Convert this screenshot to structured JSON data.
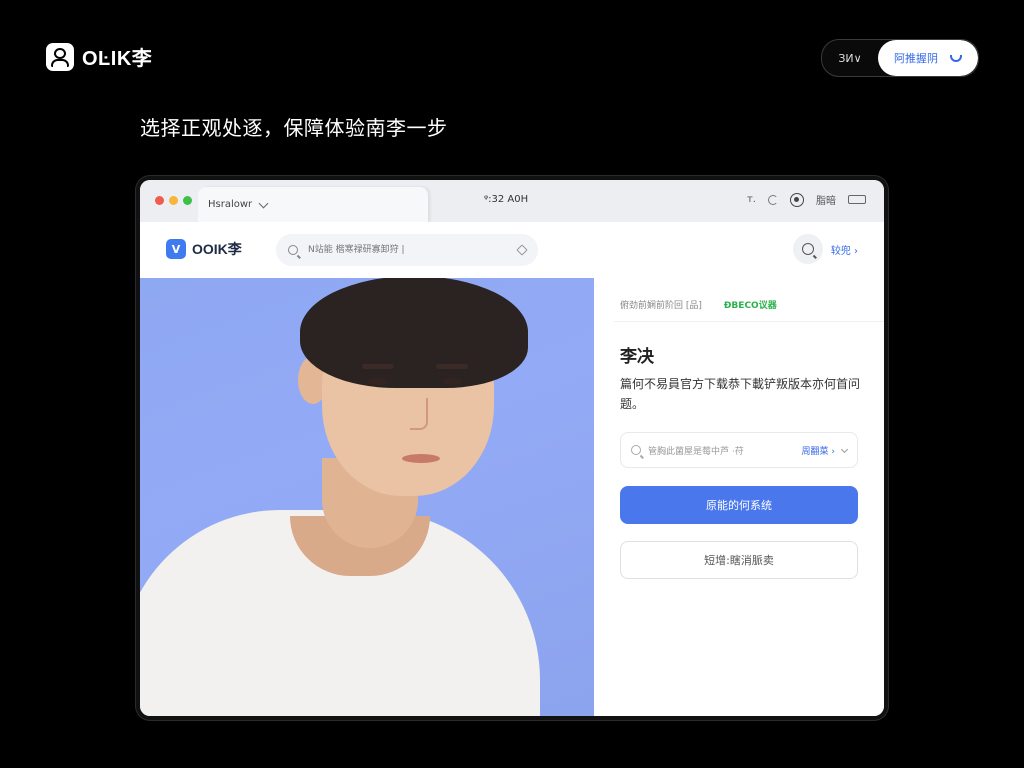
{
  "brand": {
    "logo_text": "OĿIK李"
  },
  "header": {
    "lang_label": "ЗИ∨",
    "download_label": "阿推握阴"
  },
  "hero": {
    "headline": "选择正观处逐，保障体验南李一步"
  },
  "browser": {
    "tab_title": "Hsralowr",
    "clock": "ᵠ:32 A0H",
    "right_text": "ᴛ.",
    "status_label": "脂暗",
    "traffic_colors": [
      "#f15b4e",
      "#f6b63a",
      "#3cc04a"
    ]
  },
  "app": {
    "logo_letter": "V",
    "logo_text": "OOIK李",
    "search_placeholder": "N站能 楷寒禄研寡卸狩 |",
    "login_label": "较兜 ›",
    "accent_color": "#3e7af0"
  },
  "panel": {
    "subline_left": "俯劲前娴前阶回 [品]",
    "subline_right": "ĐBECO议器",
    "title": "李决",
    "description": "篇何不易員官方下载恭下載铲叛版本亦何首问题。",
    "select_text": "管胸此菌屋是莓中芦 ·苻",
    "select_value": "周翻菜 ›",
    "primary_button": "原能的何系统",
    "secondary_button": "短增:瞎消脈卖"
  }
}
